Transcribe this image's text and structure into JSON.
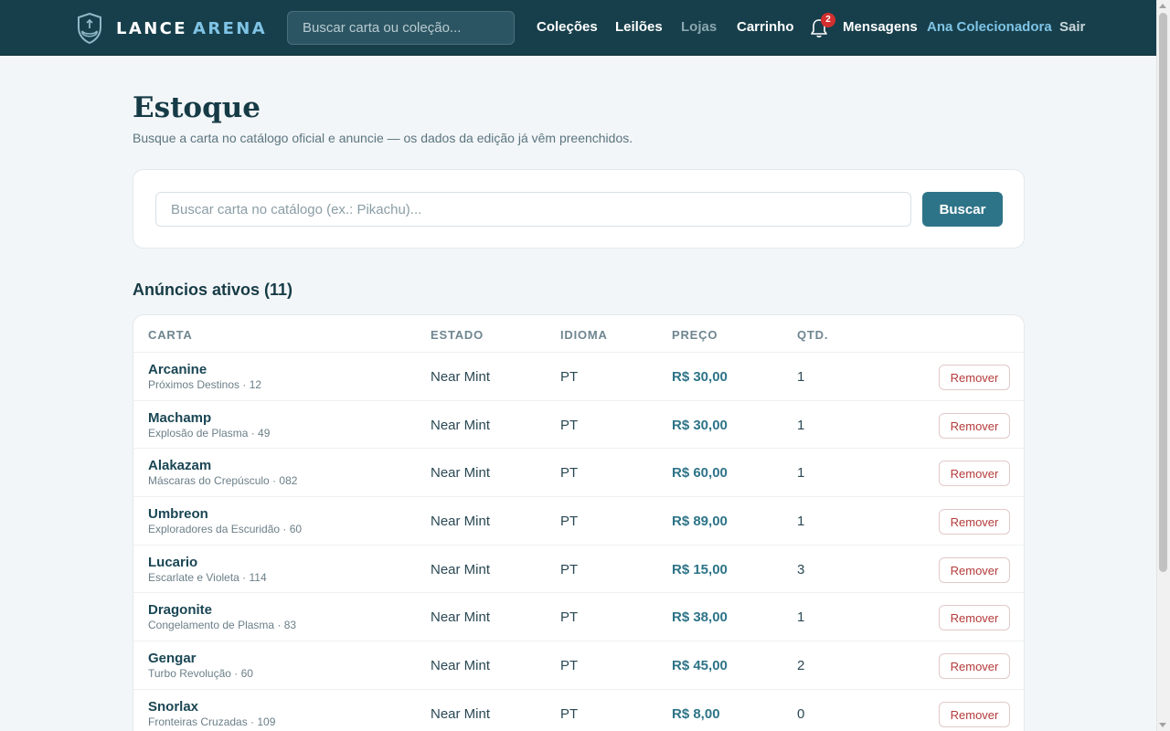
{
  "header": {
    "brand_left": "LANCE",
    "brand_right": "ARENA",
    "search_placeholder": "Buscar carta ou coleção...",
    "nav": [
      "Coleções",
      "Leilões",
      "Lojas",
      "Carrinho"
    ],
    "notification_count": "2",
    "messages_label": "Mensagens",
    "user_name": "Ana Colecionadora",
    "logout_label": "Sair"
  },
  "page": {
    "title": "Estoque",
    "subtitle": "Busque a carta no catálogo oficial e anuncie — os dados da edição já vêm preenchidos."
  },
  "catalog_search": {
    "placeholder": "Buscar carta no catálogo (ex.: Pikachu)...",
    "button_label": "Buscar"
  },
  "listings": {
    "title": "Anúncios ativos (11)",
    "columns": [
      "CARTA",
      "ESTADO",
      "IDIOMA",
      "PREÇO",
      "QTD."
    ],
    "remove_label": "Remover",
    "rows": [
      {
        "name": "Arcanine",
        "set": "Próximos Destinos · 12",
        "condition": "Near Mint",
        "language": "PT",
        "price": "R$ 30,00",
        "qty": "1"
      },
      {
        "name": "Machamp",
        "set": "Explosão de Plasma · 49",
        "condition": "Near Mint",
        "language": "PT",
        "price": "R$ 30,00",
        "qty": "1"
      },
      {
        "name": "Alakazam",
        "set": "Máscaras do Crepúsculo · 082",
        "condition": "Near Mint",
        "language": "PT",
        "price": "R$ 60,00",
        "qty": "1"
      },
      {
        "name": "Umbreon",
        "set": "Exploradores da Escuridão · 60",
        "condition": "Near Mint",
        "language": "PT",
        "price": "R$ 89,00",
        "qty": "1"
      },
      {
        "name": "Lucario",
        "set": "Escarlate e Violeta · 114",
        "condition": "Near Mint",
        "language": "PT",
        "price": "R$ 15,00",
        "qty": "3"
      },
      {
        "name": "Dragonite",
        "set": "Congelamento de Plasma · 83",
        "condition": "Near Mint",
        "language": "PT",
        "price": "R$ 38,00",
        "qty": "1"
      },
      {
        "name": "Gengar",
        "set": "Turbo Revolução · 60",
        "condition": "Near Mint",
        "language": "PT",
        "price": "R$ 45,00",
        "qty": "2"
      },
      {
        "name": "Snorlax",
        "set": "Fronteiras Cruzadas · 109",
        "condition": "Near Mint",
        "language": "PT",
        "price": "R$ 8,00",
        "qty": "0"
      }
    ]
  }
}
